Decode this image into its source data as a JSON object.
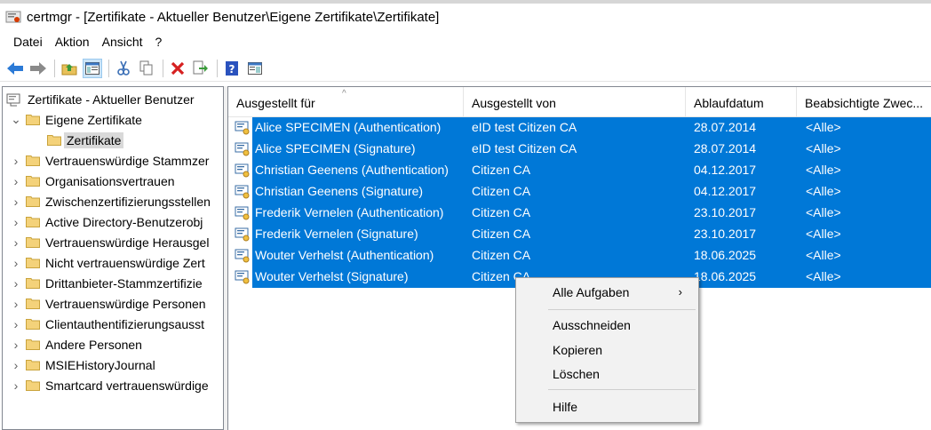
{
  "window": {
    "title": "certmgr - [Zertifikate - Aktueller Benutzer\\Eigene Zertifikate\\Zertifikate]"
  },
  "menu": [
    "Datei",
    "Aktion",
    "Ansicht",
    "?"
  ],
  "toolbar": {
    "icons": [
      "back-icon",
      "forward-icon",
      "up-folder-icon",
      "show-hide-tree-icon",
      "cut-icon",
      "copy-icon",
      "delete-icon",
      "export-icon",
      "help-icon",
      "properties-icon"
    ]
  },
  "tree": {
    "root": "Zertifikate - Aktueller Benutzer",
    "items": [
      {
        "label": "Eigene Zertifikate",
        "expanded": true
      },
      {
        "label": "Zertifikate",
        "selected": true
      },
      {
        "label": "Vertrauenswürdige Stammzer"
      },
      {
        "label": "Organisationsvertrauen"
      },
      {
        "label": "Zwischenzertifizierungsstellen"
      },
      {
        "label": "Active Directory-Benutzerobj"
      },
      {
        "label": "Vertrauenswürdige Herausgel"
      },
      {
        "label": "Nicht vertrauenswürdige Zert"
      },
      {
        "label": "Drittanbieter-Stammzertifizie"
      },
      {
        "label": "Vertrauenswürdige Personen"
      },
      {
        "label": "Clientauthentifizierungsausst"
      },
      {
        "label": "Andere Personen"
      },
      {
        "label": "MSIEHistoryJournal"
      },
      {
        "label": "Smartcard vertrauenswürdige"
      }
    ]
  },
  "list": {
    "columns": [
      "Ausgestellt für",
      "Ausgestellt von",
      "Ablaufdatum",
      "Beabsichtigte Zwec..."
    ],
    "rows": [
      {
        "issued_to": "Alice SPECIMEN (Authentication)",
        "issued_by": "eID test Citizen CA",
        "expiry": "28.07.2014",
        "purpose": "<Alle>"
      },
      {
        "issued_to": "Alice SPECIMEN (Signature)",
        "issued_by": "eID test Citizen CA",
        "expiry": "28.07.2014",
        "purpose": "<Alle>"
      },
      {
        "issued_to": "Christian Geenens (Authentication)",
        "issued_by": "Citizen CA",
        "expiry": "04.12.2017",
        "purpose": "<Alle>"
      },
      {
        "issued_to": "Christian Geenens (Signature)",
        "issued_by": "Citizen CA",
        "expiry": "04.12.2017",
        "purpose": "<Alle>"
      },
      {
        "issued_to": "Frederik Vernelen (Authentication)",
        "issued_by": "Citizen CA",
        "expiry": "23.10.2017",
        "purpose": "<Alle>"
      },
      {
        "issued_to": "Frederik Vernelen (Signature)",
        "issued_by": "Citizen CA",
        "expiry": "23.10.2017",
        "purpose": "<Alle>"
      },
      {
        "issued_to": "Wouter Verhelst (Authentication)",
        "issued_by": "Citizen CA",
        "expiry": "18.06.2025",
        "purpose": "<Alle>"
      },
      {
        "issued_to": "Wouter Verhelst (Signature)",
        "issued_by": "Citizen CA",
        "expiry": "18.06.2025",
        "purpose": "<Alle>"
      }
    ]
  },
  "context_menu": {
    "items": [
      "Alle Aufgaben",
      "Ausschneiden",
      "Kopieren",
      "Löschen",
      "Hilfe"
    ],
    "submenu_arrow": "›"
  },
  "colors": {
    "selection": "#0078d7",
    "context_bg": "#f2f2f2"
  }
}
